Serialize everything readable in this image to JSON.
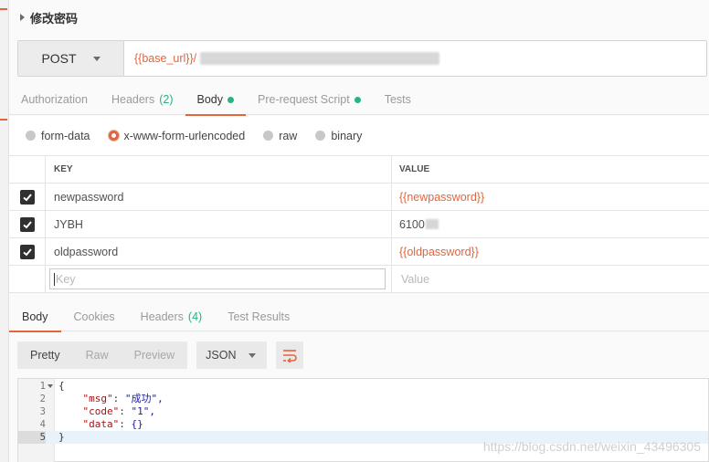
{
  "request": {
    "title": "修改密码",
    "method": "POST",
    "url_prefix": "{{base_url}}/"
  },
  "request_tabs": [
    {
      "label": "Authorization",
      "count": "",
      "dot": false,
      "active": false
    },
    {
      "label": "Headers",
      "count": "(2)",
      "dot": false,
      "active": false
    },
    {
      "label": "Body",
      "count": "",
      "dot": true,
      "active": true
    },
    {
      "label": "Pre-request Script",
      "count": "",
      "dot": true,
      "active": false
    },
    {
      "label": "Tests",
      "count": "",
      "dot": false,
      "active": false
    }
  ],
  "body_types": [
    {
      "label": "form-data",
      "selected": false
    },
    {
      "label": "x-www-form-urlencoded",
      "selected": true
    },
    {
      "label": "raw",
      "selected": false
    },
    {
      "label": "binary",
      "selected": false
    }
  ],
  "params_table": {
    "headers": {
      "key": "KEY",
      "value": "VALUE"
    },
    "rows": [
      {
        "checked": true,
        "key": "newpassword",
        "value": "{{newpassword}}"
      },
      {
        "checked": true,
        "key": "JYBH",
        "value": "6100"
      },
      {
        "checked": true,
        "key": "oldpassword",
        "value": "{{oldpassword}}"
      }
    ],
    "new_row": {
      "key_placeholder": "Key",
      "value_placeholder": "Value"
    }
  },
  "response_tabs": [
    {
      "label": "Body",
      "count": "",
      "active": true
    },
    {
      "label": "Cookies",
      "count": "",
      "active": false
    },
    {
      "label": "Headers",
      "count": "(4)",
      "active": false
    },
    {
      "label": "Test Results",
      "count": "",
      "active": false
    }
  ],
  "response_toolbar": {
    "views": [
      "Pretty",
      "Raw",
      "Preview"
    ],
    "active_view": "Pretty",
    "format": "JSON"
  },
  "response_body": {
    "line_numbers": [
      "1",
      "2",
      "3",
      "4",
      "5"
    ],
    "open_brace": "{",
    "close_brace": "}",
    "fields": [
      {
        "key": "\"msg\"",
        "value": "\"成功\","
      },
      {
        "key": "\"code\"",
        "value": "\"1\","
      },
      {
        "key": "\"data\"",
        "value": "{}"
      }
    ]
  },
  "watermark": "https://blog.csdn.net/weixin_43496305",
  "colors": {
    "accent": "#e4643b",
    "success": "#26b47f"
  }
}
